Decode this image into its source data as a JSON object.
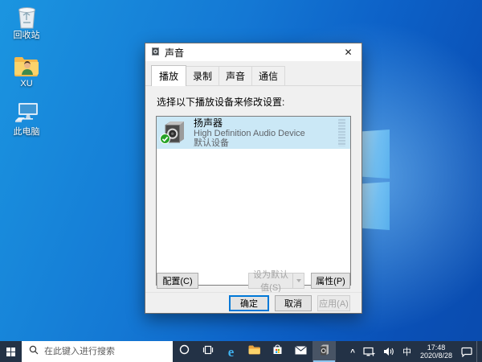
{
  "desktop": {
    "icons": [
      {
        "id": "recycle-bin",
        "label": "回收站"
      },
      {
        "id": "user-folder",
        "label": "XU"
      },
      {
        "id": "this-pc",
        "label": "此电脑"
      }
    ]
  },
  "dialog": {
    "title": "声音",
    "close_glyph": "✕",
    "tabs": [
      {
        "label": "播放",
        "active": true
      },
      {
        "label": "录制",
        "active": false
      },
      {
        "label": "声音",
        "active": false
      },
      {
        "label": "通信",
        "active": false
      }
    ],
    "instruction": "选择以下播放设备来修改设置:",
    "devices": [
      {
        "name": "扬声器",
        "description": "High Definition Audio Device",
        "status": "默认设备",
        "selected": true,
        "is_default": true
      }
    ],
    "buttons": {
      "configure": "配置(C)",
      "set_default": "设为默认值(S)",
      "set_default_disabled": true,
      "properties": "属性(P)",
      "ok": "确定",
      "cancel": "取消",
      "apply": "应用(A)",
      "apply_disabled": true
    }
  },
  "taskbar": {
    "search_placeholder": "在此键入进行搜索",
    "icons": [
      "cortana",
      "task-view",
      "edge",
      "file-explorer",
      "store",
      "mail",
      "sound-app"
    ],
    "edge_glyph": "e",
    "active_app": "sound-app",
    "tray": {
      "hidden_icons_glyph": "^",
      "ime": "中",
      "time": "17:48",
      "date": "2020/8/28"
    }
  },
  "colors": {
    "accent": "#0078d7",
    "selection": "#cbe8f6",
    "taskbar": "#233246",
    "wallpaper_light": "#1b95e0",
    "wallpaper_dark": "#0a4bae",
    "default_badge": "#27a327",
    "dialog_bg": "#f0f0f0"
  }
}
